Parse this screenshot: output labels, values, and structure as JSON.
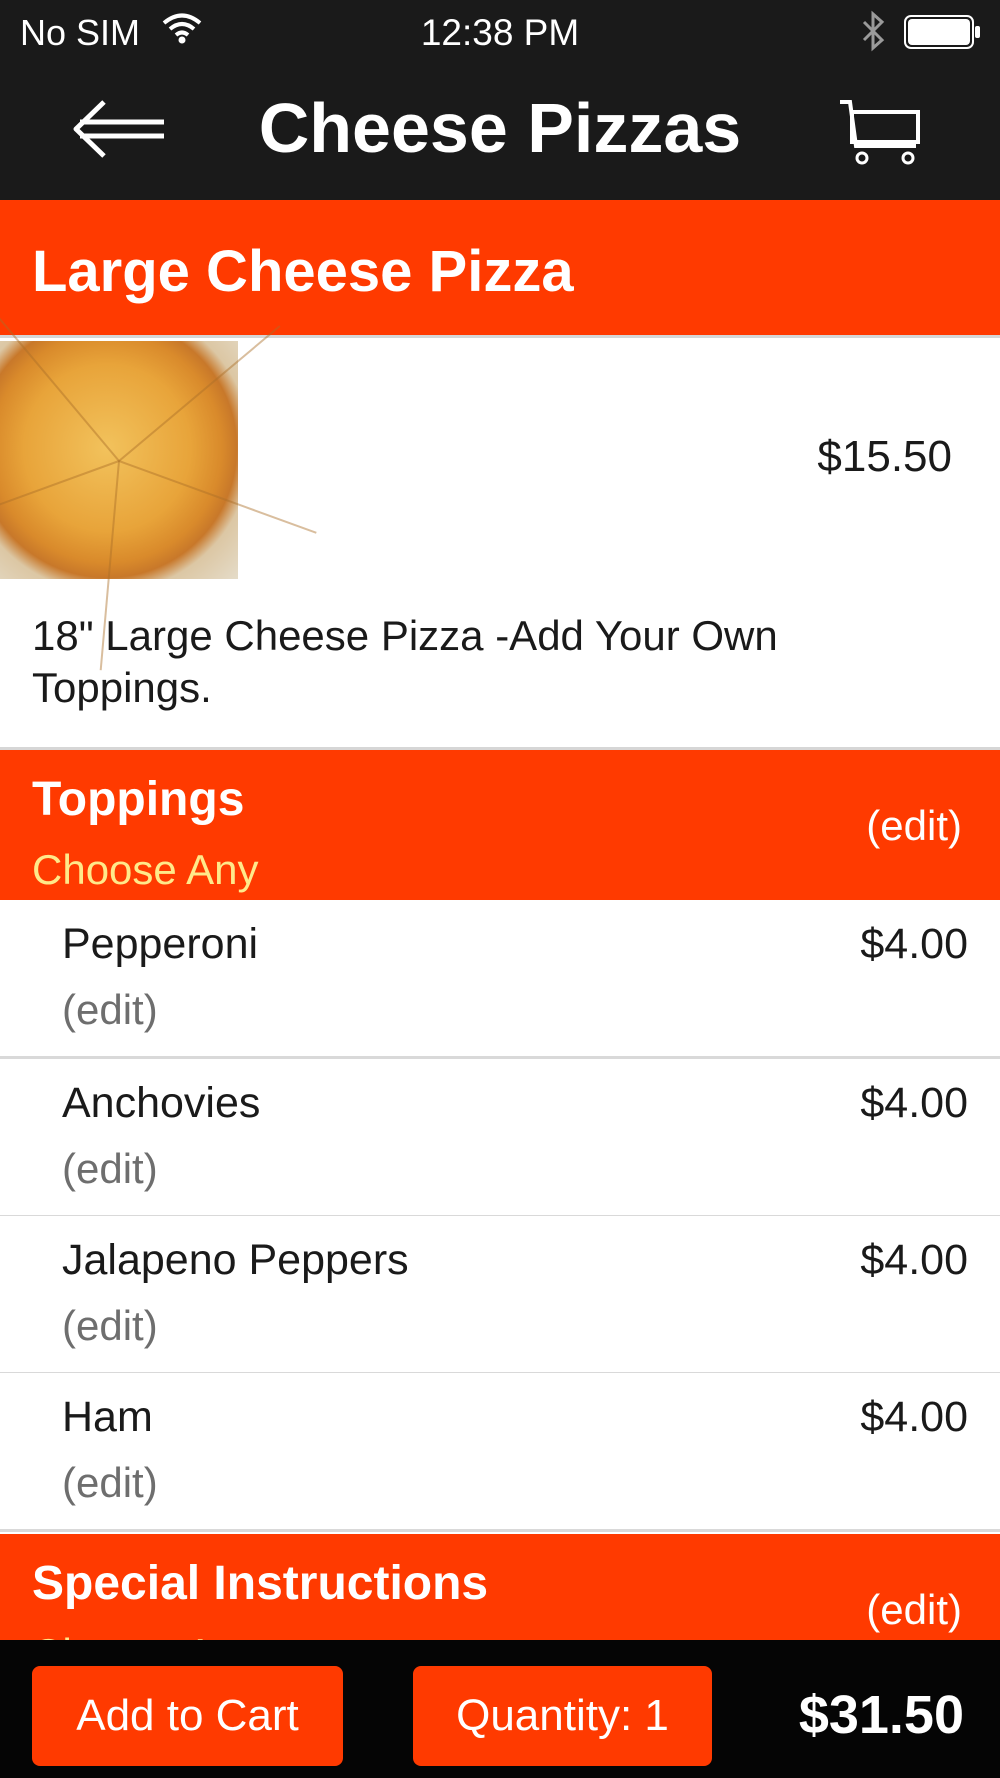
{
  "status_bar": {
    "carrier": "No SIM",
    "time": "12:38 PM",
    "icons": [
      "wifi-icon",
      "bluetooth-icon",
      "battery-icon"
    ]
  },
  "nav": {
    "title": "Cheese Pizzas",
    "back_icon": "back-arrow-icon",
    "cart_icon": "shopping-cart-icon"
  },
  "item": {
    "name": "Large Cheese Pizza",
    "price": "$15.50",
    "description": "18\" Large Cheese Pizza -Add Your Own Toppings."
  },
  "groups": [
    {
      "name": "Toppings",
      "subtitle": "Choose Any",
      "edit_label": "(edit)",
      "options": [
        {
          "name": "Pepperoni",
          "price": "$4.00",
          "edit_label": "(edit)"
        },
        {
          "name": "Anchovies",
          "price": "$4.00",
          "edit_label": "(edit)"
        },
        {
          "name": "Jalapeno Peppers",
          "price": "$4.00",
          "edit_label": "(edit)"
        },
        {
          "name": "Ham",
          "price": "$4.00",
          "edit_label": "(edit)"
        }
      ]
    },
    {
      "name": "Special Instructions",
      "subtitle": "Choose Any",
      "edit_label": "(edit)"
    }
  ],
  "footer": {
    "add_to_cart_label": "Add to Cart",
    "quantity_label": "Quantity: 1",
    "total": "$31.50"
  },
  "colors": {
    "accent": "#ff3a00",
    "bar": "#1a1a1a",
    "subtitle": "#ffe98a"
  }
}
